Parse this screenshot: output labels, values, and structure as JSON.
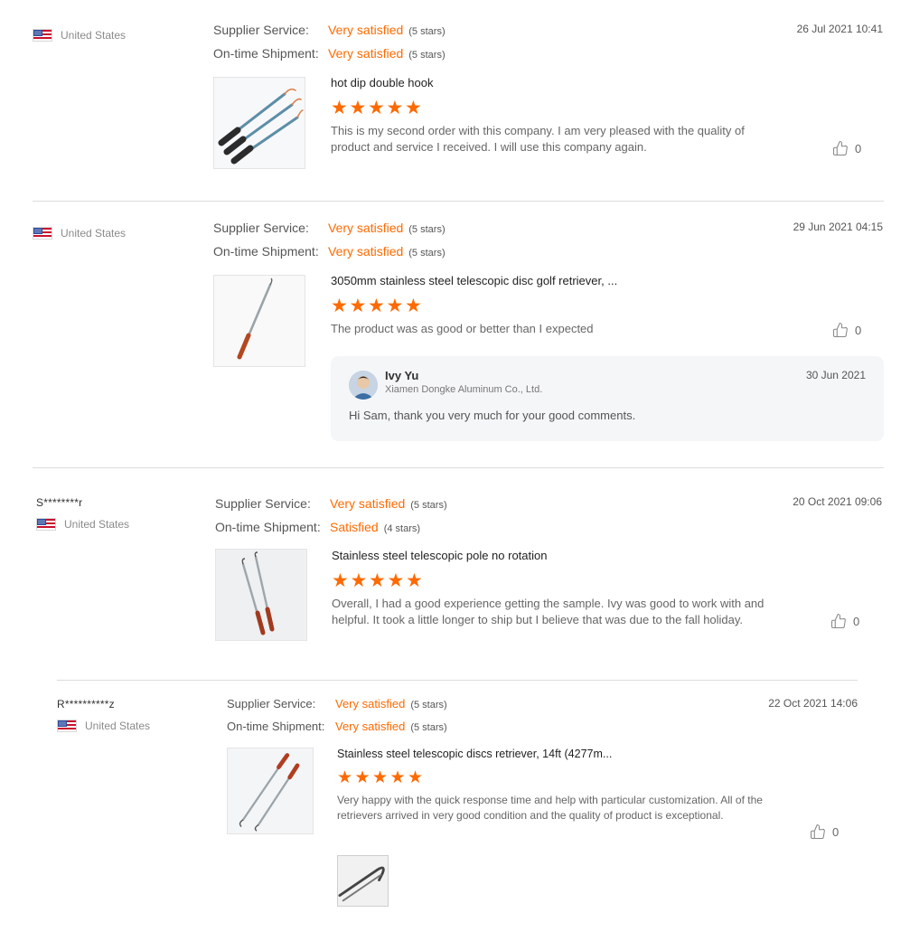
{
  "reviews": [
    {
      "buyer_name": "",
      "country": "United States",
      "date": "26 Jul 2021 10:41",
      "ratings": [
        {
          "label": "Supplier Service:",
          "value": "Very satisfied",
          "stars": "(5 stars)"
        },
        {
          "label": "On-time Shipment:",
          "value": "Very satisfied",
          "stars": "(5 stars)"
        }
      ],
      "product_title": "hot dip double hook",
      "star_rating": 5,
      "comment": "This is my second order with this company. I am very pleased with the quality of product and service I received. I will use this company again.",
      "likes": "0"
    },
    {
      "buyer_name": "",
      "country": "United States",
      "date": "29 Jun 2021 04:15",
      "ratings": [
        {
          "label": "Supplier Service:",
          "value": "Very satisfied",
          "stars": "(5 stars)"
        },
        {
          "label": "On-time Shipment:",
          "value": "Very satisfied",
          "stars": "(5 stars)"
        }
      ],
      "product_title": "3050mm stainless steel telescopic disc golf retriever, ...",
      "star_rating": 5,
      "comment": "The product was as good or better than I expected",
      "likes": "0",
      "reply": {
        "name": "Ivy Yu",
        "company": "Xiamen Dongke Aluminum Co., Ltd.",
        "date": "30 Jun 2021",
        "text": "Hi Sam, thank you very much for your good comments."
      }
    },
    {
      "buyer_name": "S********r",
      "country": "United States",
      "date": "20 Oct 2021 09:06",
      "ratings": [
        {
          "label": "Supplier Service:",
          "value": "Very satisfied",
          "stars": "(5 stars)"
        },
        {
          "label": "On-time Shipment:",
          "value": "Satisfied",
          "stars": "(4 stars)"
        }
      ],
      "product_title": "Stainless steel telescopic pole no rotation",
      "star_rating": 5,
      "comment": "Overall, I had a good experience getting the sample. Ivy was good to work with and helpful. It took a little longer to ship but I believe that was due to the fall holiday.",
      "likes": "0"
    },
    {
      "buyer_name": "R**********z",
      "country": "United States",
      "date": "22 Oct 2021 14:06",
      "ratings": [
        {
          "label": "Supplier Service:",
          "value": "Very satisfied",
          "stars": "(5 stars)"
        },
        {
          "label": "On-time Shipment:",
          "value": "Very satisfied",
          "stars": "(5 stars)"
        }
      ],
      "product_title": "Stainless steel telescopic discs retriever, 14ft (4277m...",
      "star_rating": 5,
      "comment": "Very happy with the quick response time and help with particular customization. All of the retrievers arrived in very good condition and the quality of product is exceptional.",
      "likes": "0"
    }
  ],
  "icons": {
    "flag": "us-flag-icon",
    "star": "star-icon",
    "like": "thumbs-up-icon"
  },
  "colors": {
    "accent": "#ff6a00",
    "divider": "#dcdcdc",
    "reply_bg": "#f5f6f8"
  }
}
